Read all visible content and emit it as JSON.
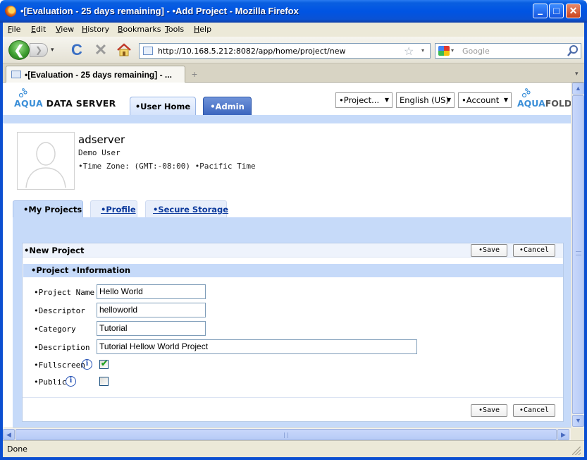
{
  "window": {
    "title": "•[Evaluation - 25 days remaining] - •Add Project - Mozilla Firefox",
    "min_glyph": "–",
    "max_glyph": "□",
    "close_glyph": "✕"
  },
  "menubar": {
    "items": [
      "File",
      "Edit",
      "View",
      "History",
      "Bookmarks",
      "Tools",
      "Help"
    ]
  },
  "navbar": {
    "back_glyph": "❮",
    "forward_glyph": "❯",
    "dropdown_glyph": "▾",
    "reload_glyph": "C",
    "stop_glyph": "✕",
    "url": "http://10.168.5.212:8082/app/home/project/new",
    "star_glyph": "☆",
    "search_placeholder": "Google"
  },
  "browser_tabs": [
    {
      "label": "•[Evaluation - 25 days remaining] - ...",
      "active": true
    }
  ],
  "new_tab_glyph": "+",
  "app": {
    "logo_left": {
      "accent": "AQUA",
      "rest": " DATA SERVER"
    },
    "logo_right": {
      "accent": "AQUA",
      "rest": "FOLD"
    },
    "tabs": [
      {
        "label": "•User Home",
        "active": true
      },
      {
        "label": "•Admin",
        "active": false
      }
    ],
    "header_dropdowns": {
      "project": "•Project...",
      "language": "English (US)",
      "account": "•Account"
    },
    "caret": "▼",
    "user": {
      "username": "adserver",
      "full_name": "Demo User",
      "timezone": "•Time Zone: (GMT:-08:00) •Pacific Time"
    },
    "sub_tabs": [
      {
        "label": "•My Projects",
        "active": true
      },
      {
        "label": "•Profile",
        "active": false
      },
      {
        "label": "•Secure Storage",
        "active": false
      }
    ],
    "panel": {
      "title": "•New Project",
      "save_label": "•Save",
      "cancel_label": "•Cancel",
      "section_title": "•Project •Information",
      "fields": {
        "project_name": {
          "label": "•Project Name",
          "value": "Hello World"
        },
        "descriptor": {
          "label": "•Descriptor",
          "value": "helloworld"
        },
        "category": {
          "label": "•Category",
          "value": "Tutorial"
        },
        "description": {
          "label": "•Description",
          "value": "Tutorial Hellow World Project"
        },
        "fullscreen": {
          "label": "•Fullscreen",
          "checked": true
        },
        "public": {
          "label": "•Public",
          "checked": false
        }
      },
      "info_glyph": "i",
      "tick_glyph": "✔"
    }
  },
  "status": {
    "text": "Done"
  },
  "colors": {
    "titlebar": "#0054e3",
    "band_blue": "#c6daf9",
    "admin_tab": "#3c66bf",
    "link_blue": "#0d3a9c",
    "checkbox_tick": "#21a121"
  }
}
